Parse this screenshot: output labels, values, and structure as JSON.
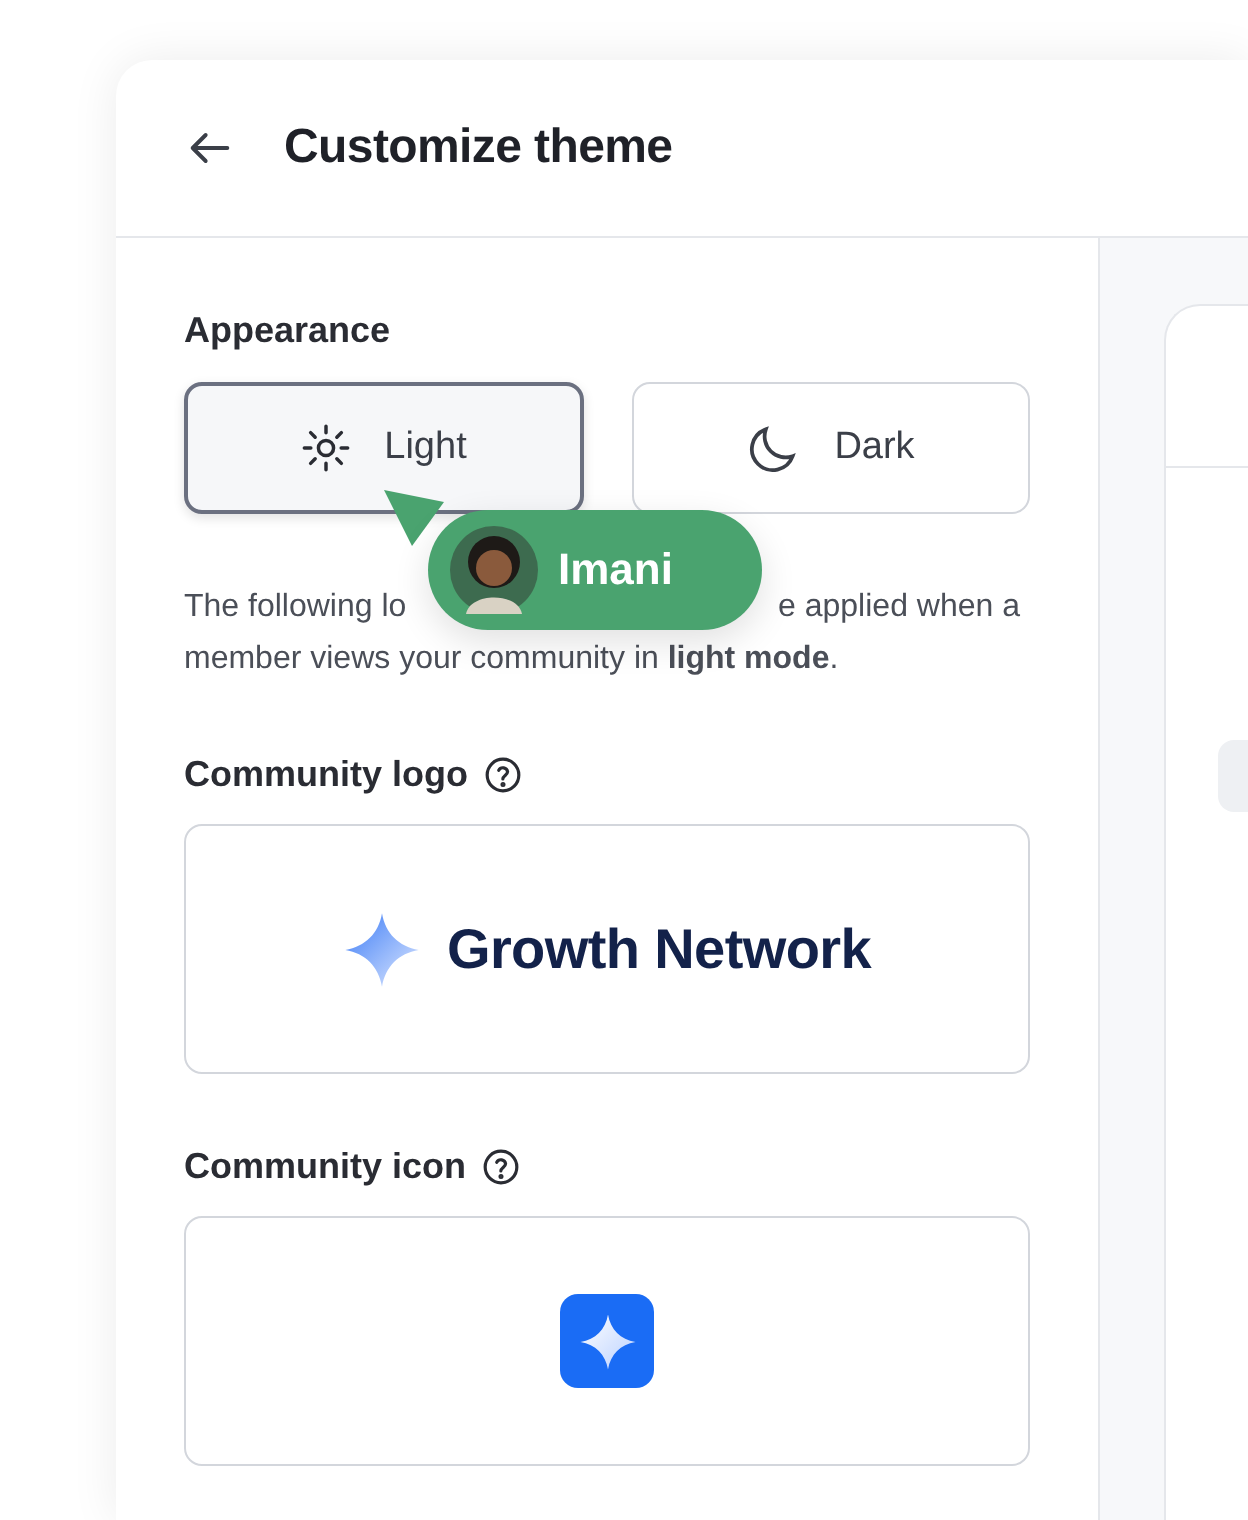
{
  "header": {
    "title": "Customize theme"
  },
  "appearance": {
    "label": "Appearance",
    "options": [
      {
        "kind": "light",
        "label": "Light",
        "selected": true
      },
      {
        "kind": "dark",
        "label": "Dark",
        "selected": false
      }
    ]
  },
  "cursor": {
    "name": "Imani"
  },
  "description": {
    "fragments": [
      "The following lo",
      "e applied when a"
    ],
    "line2": "member views your community in **light mode**."
  },
  "logo_section": {
    "label": "Community logo",
    "brand": "Growth Network"
  },
  "icon_section": {
    "label": "Community icon"
  }
}
